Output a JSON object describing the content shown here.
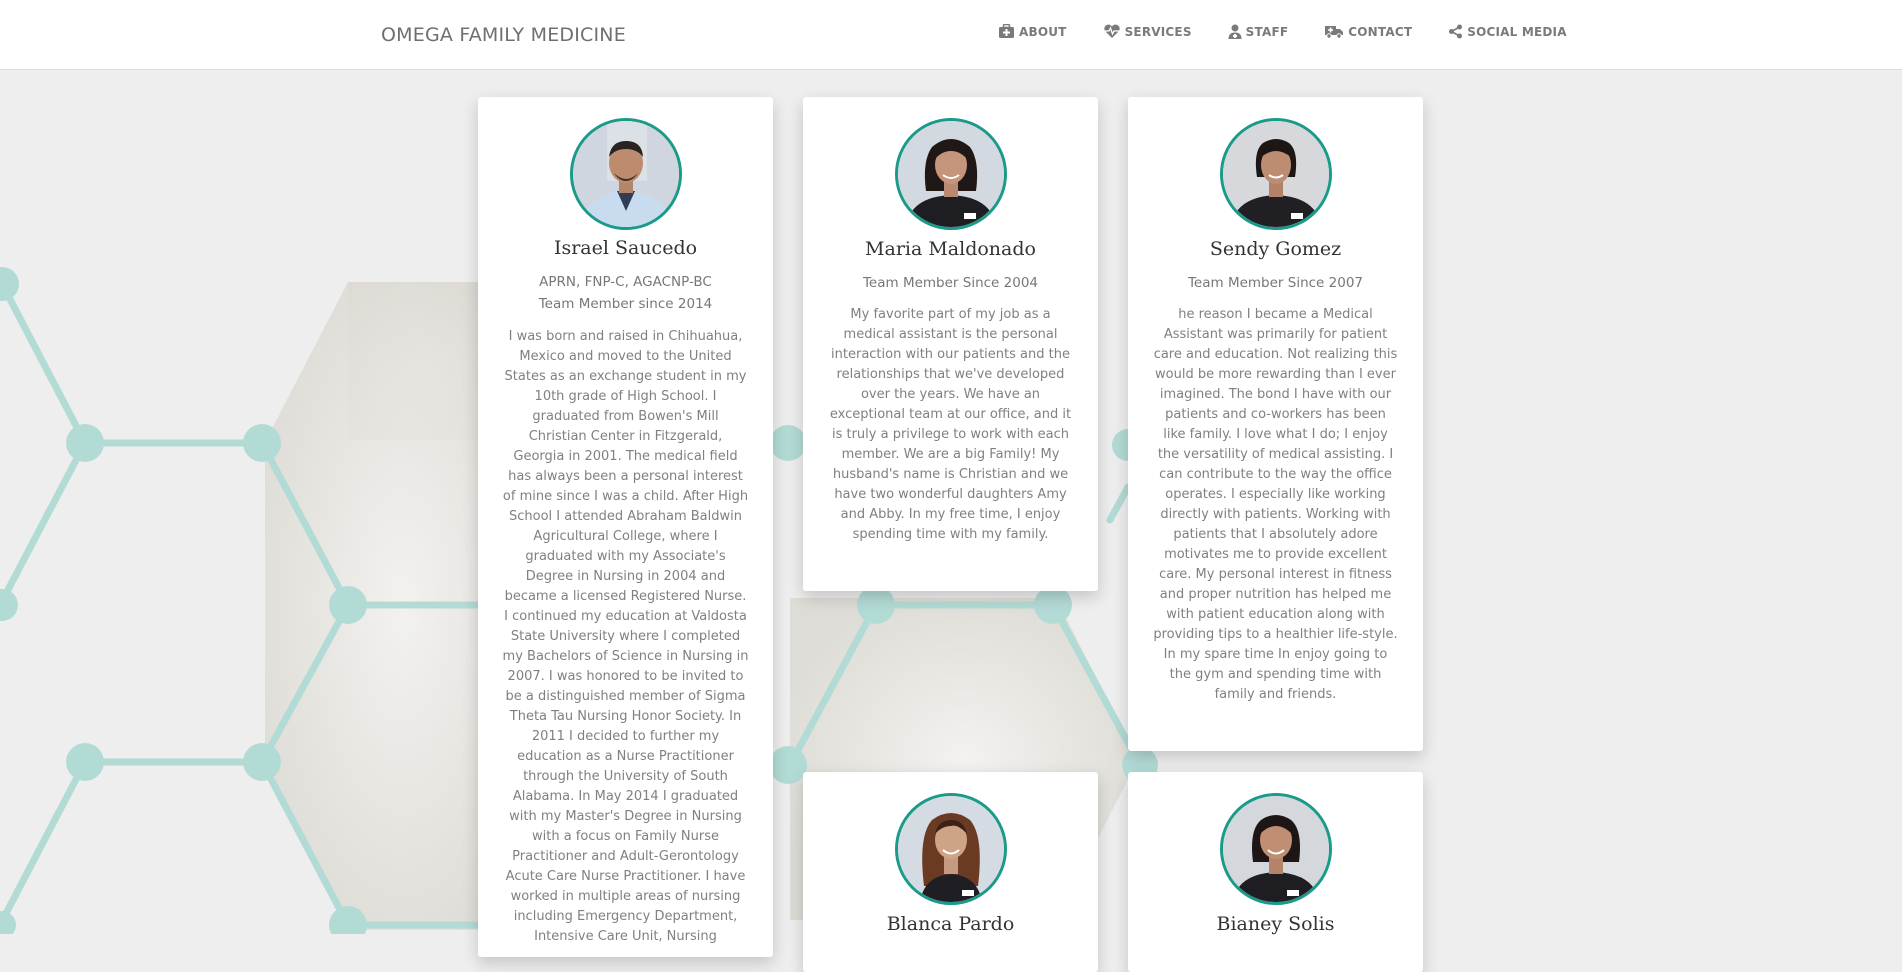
{
  "brand": "OMEGA FAMILY MEDICINE",
  "nav": [
    {
      "label": "ABOUT",
      "icon": "briefcase-medical-icon"
    },
    {
      "label": "SERVICES",
      "icon": "heart-pulse-icon"
    },
    {
      "label": "STAFF",
      "icon": "user-doctor-icon"
    },
    {
      "label": "CONTACT",
      "icon": "ambulance-icon"
    },
    {
      "label": "SOCIAL MEDIA",
      "icon": "share-icon"
    }
  ],
  "colors": {
    "accent": "#1a9a88",
    "hex_line": "#b3dbd6"
  },
  "staff": [
    {
      "name": "Israel Saucedo",
      "credentials": "APRN, FNP-C, AGACNP-BC",
      "since": "Team Member since 2014",
      "bio": "I was born and raised in Chihuahua, Mexico and moved to the United States as an exchange student in my 10th grade of High School. I graduated from Bowen's Mill Christian Center in Fitzgerald, Georgia in 2001. The medical field has always been a personal interest of mine since I was a child. After High School I attended Abraham Baldwin Agricultural College, where I graduated with my Associate's Degree in Nursing in 2004 and became a licensed Registered Nurse. I continued my education at Valdosta State University where I completed my Bachelors of Science in Nursing in 2007. I was honored to be invited to be a distinguished member of Sigma Theta Tau Nursing Honor Society. In 2011 I decided to further my education as a Nurse Practitioner through the University of South Alabama. In May 2014 I graduated with my Master's Degree in Nursing with a focus on Family Nurse Practitioner and Adult-Gerontology Acute Care Nurse Practitioner. I have worked in multiple areas of nursing including Emergency Department, Intensive Care Unit, Nursing"
    },
    {
      "name": "Maria Maldonado",
      "since": "Team Member Since 2004",
      "bio": "My favorite part of my job as a medical assistant is the personal interaction with our patients and the relationships that we've developed over the years. We have an exceptional team at our office, and it is truly a privilege to work with each member. We are a big Family! My husband's name is Christian and we have two wonderful daughters Amy and Abby. In my free time, I enjoy spending time with my family."
    },
    {
      "name": "Sendy Gomez",
      "since": "Team Member Since 2007",
      "bio": "he reason I became a Medical Assistant was primarily for patient care and education. Not realizing this would be more rewarding than I ever imagined. The bond I have with our patients and co-workers has been like family. I love what I do; I enjoy the versatility of medical assisting. I can contribute to the way the office operates. I especially like working directly with patients. Working with patients that I absolutely adore motivates me to provide excellent care. My personal interest in fitness and proper nutrition has helped me with patient education along with providing tips to a healthier life-style. In my spare time In enjoy going to the gym and spending time with family and friends."
    },
    {
      "name": "Blanca Pardo"
    },
    {
      "name": "Bianey Solis"
    }
  ]
}
